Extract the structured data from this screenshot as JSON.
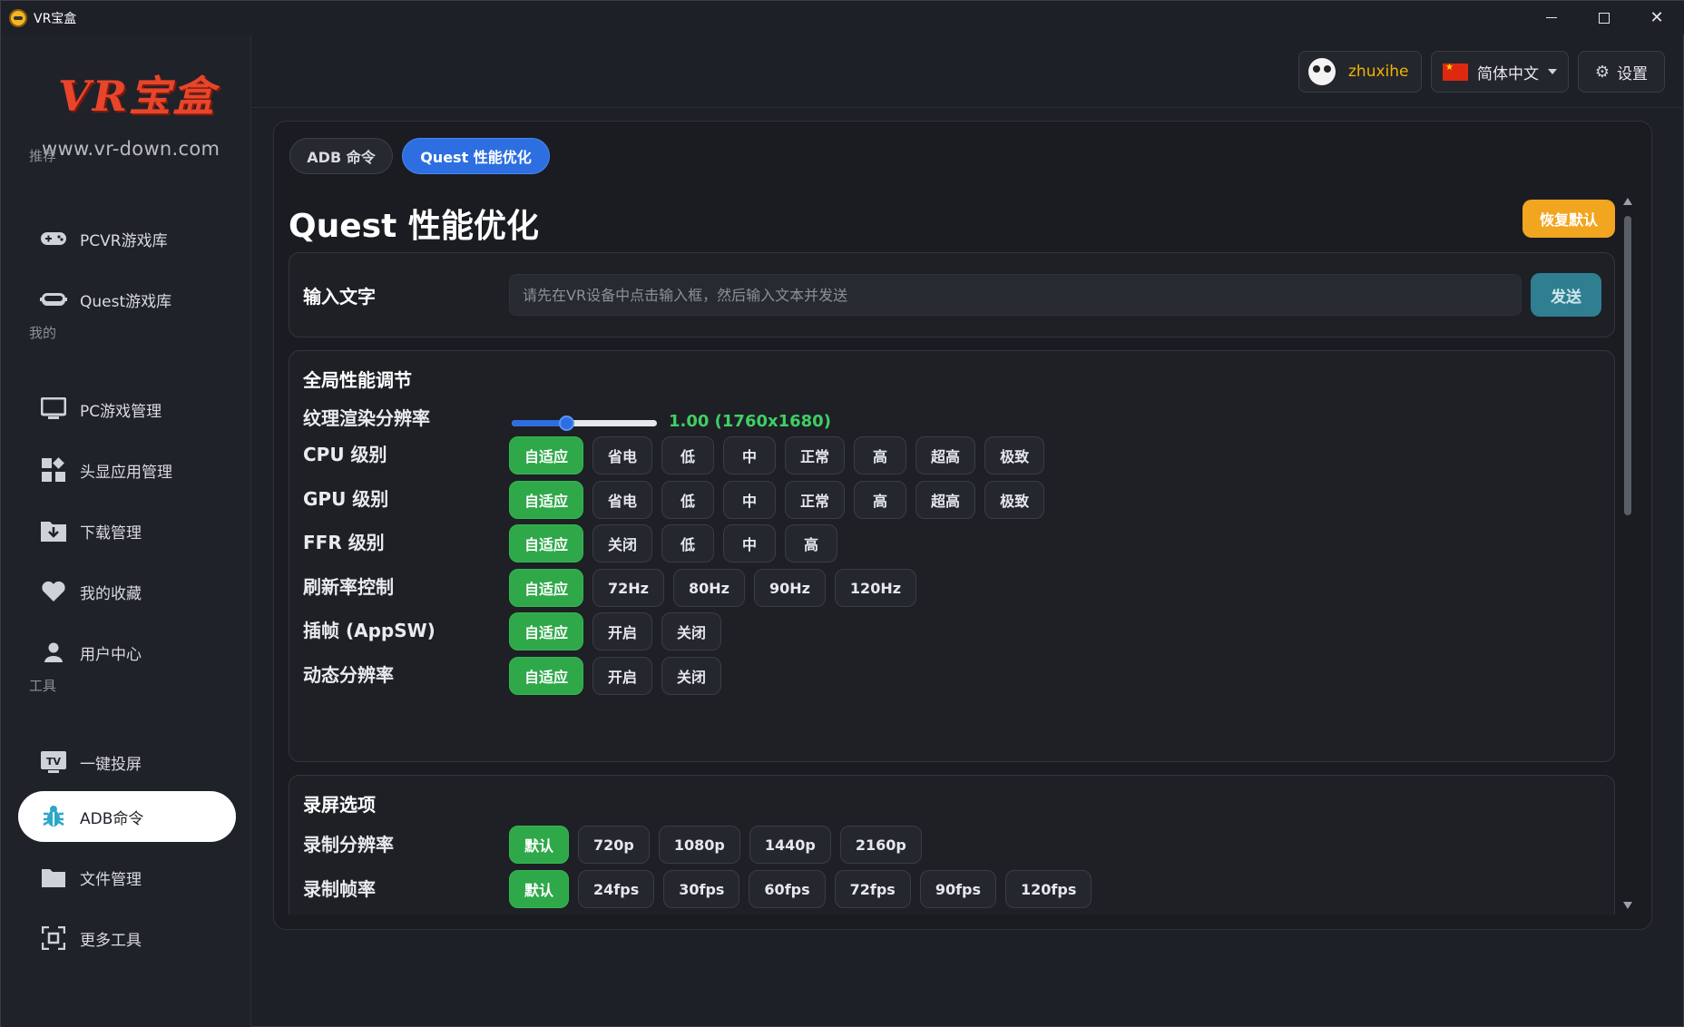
{
  "window": {
    "title": "VR宝盒"
  },
  "sidebar": {
    "logo_text": "VR宝盒",
    "logo_url": "www.vr-down.com",
    "sections": {
      "recommend": "推荐",
      "mine": "我的",
      "tools": "工具"
    },
    "items": [
      {
        "label": "PCVR游戏库",
        "icon": "gamepad-icon"
      },
      {
        "label": "Quest游戏库",
        "icon": "vr-headset-icon"
      },
      {
        "label": "PC游戏管理",
        "icon": "monitor-icon"
      },
      {
        "label": "头显应用管理",
        "icon": "apps-grid-icon"
      },
      {
        "label": "下载管理",
        "icon": "download-folder-icon"
      },
      {
        "label": "我的收藏",
        "icon": "heart-icon"
      },
      {
        "label": "用户中心",
        "icon": "user-icon"
      },
      {
        "label": "一键投屏",
        "icon": "tv-icon",
        "icon_text": "TV"
      },
      {
        "label": "ADB命令",
        "icon": "bug-icon",
        "active": true
      },
      {
        "label": "文件管理",
        "icon": "folder-icon"
      },
      {
        "label": "更多工具",
        "icon": "scan-icon"
      }
    ]
  },
  "header": {
    "username": "zhuxihe",
    "language": "简体中文",
    "settings_label": "设置"
  },
  "tabs": [
    {
      "label": "ADB 命令",
      "active": false
    },
    {
      "label": "Quest 性能优化",
      "active": true
    }
  ],
  "page": {
    "title": "Quest 性能优化",
    "reset_label": "恢复默认"
  },
  "text_input": {
    "label": "输入文字",
    "placeholder": "请先在VR设备中点击输入框，然后输入文本并发送",
    "value": "",
    "send_label": "发送"
  },
  "perf": {
    "title": "全局性能调节",
    "texture": {
      "label": "纹理渲染分辨率",
      "value_text": "1.00 (1760x1680)",
      "slider_fraction": 0.38
    },
    "rows": [
      {
        "label": "CPU 级别",
        "options": [
          "自适应",
          "省电",
          "低",
          "中",
          "正常",
          "高",
          "超高",
          "极致"
        ],
        "selected": 0
      },
      {
        "label": "GPU 级别",
        "options": [
          "自适应",
          "省电",
          "低",
          "中",
          "正常",
          "高",
          "超高",
          "极致"
        ],
        "selected": 0
      },
      {
        "label": "FFR 级别",
        "options": [
          "自适应",
          "关闭",
          "低",
          "中",
          "高"
        ],
        "selected": 0
      },
      {
        "label": "刷新率控制",
        "options": [
          "自适应",
          "72Hz",
          "80Hz",
          "90Hz",
          "120Hz"
        ],
        "selected": 0
      },
      {
        "label": "插帧 (AppSW)",
        "options": [
          "自适应",
          "开启",
          "关闭"
        ],
        "selected": 0
      },
      {
        "label": "动态分辨率",
        "options": [
          "自适应",
          "开启",
          "关闭"
        ],
        "selected": 0
      }
    ]
  },
  "record": {
    "title": "录屏选项",
    "rows": [
      {
        "label": "录制分辨率",
        "options": [
          "默认",
          "720p",
          "1080p",
          "1440p",
          "2160p"
        ],
        "selected": 0
      },
      {
        "label": "录制帧率",
        "options": [
          "默认",
          "24fps",
          "30fps",
          "60fps",
          "72fps",
          "90fps",
          "120fps"
        ],
        "selected": 0
      }
    ]
  },
  "colors": {
    "accent_blue": "#2d6fe0",
    "active_green": "#2fa84a",
    "reset_orange": "#f2a51f",
    "send_teal": "#2f7f91",
    "username_gold": "#f0b400",
    "value_green": "#3fcf63"
  }
}
